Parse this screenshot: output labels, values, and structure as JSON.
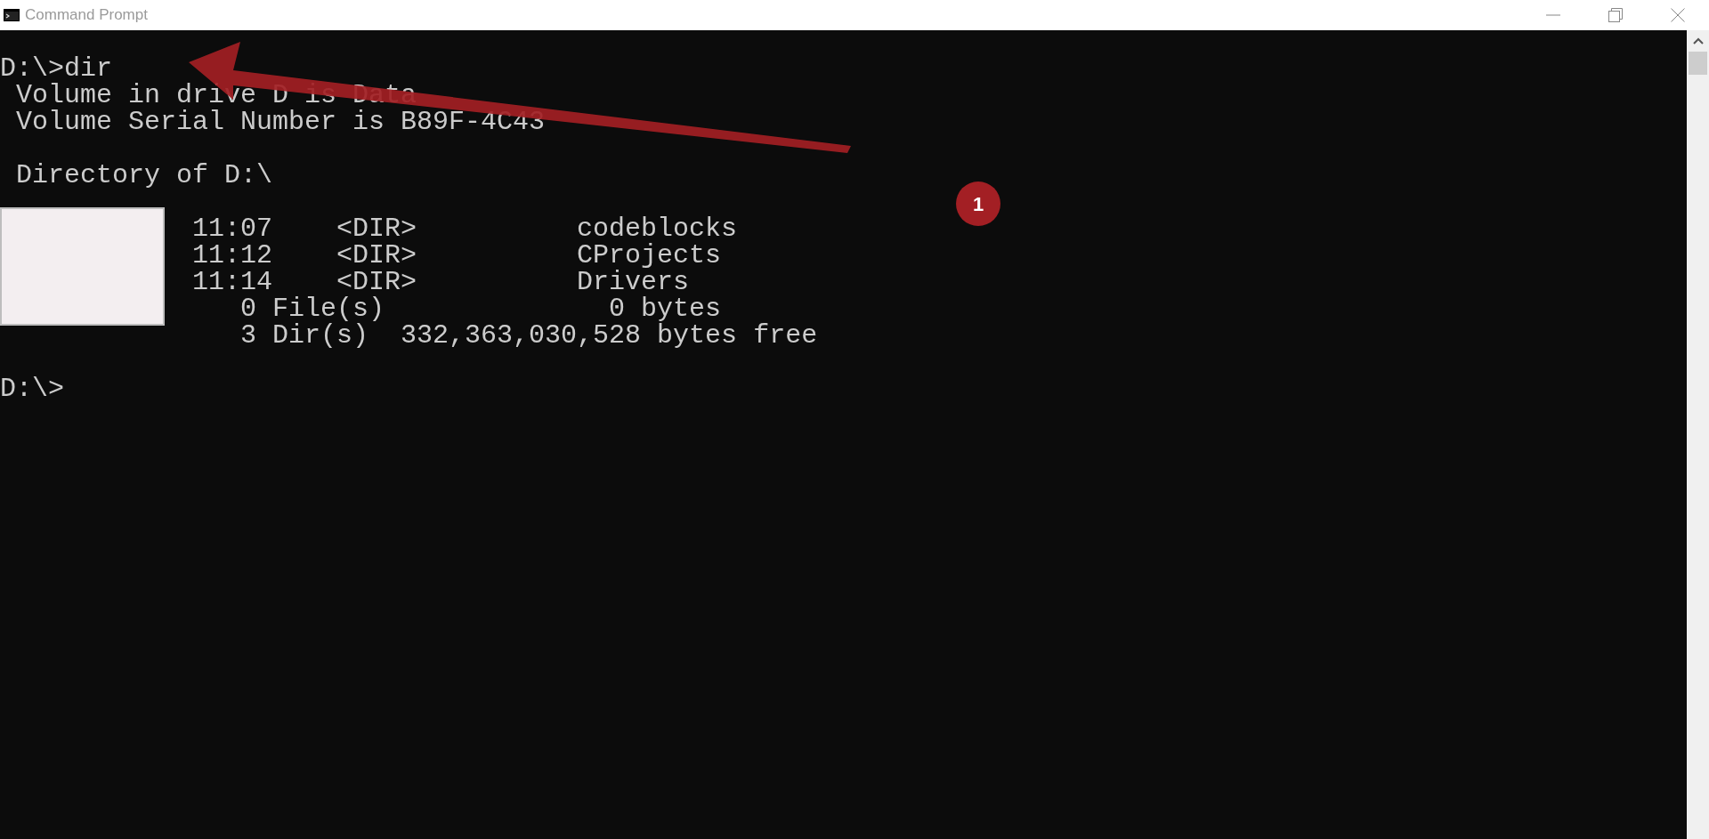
{
  "window": {
    "title": "Command Prompt"
  },
  "terminal": {
    "prompt": "D:\\>",
    "command": "dir",
    "volume_lines": [
      "Volume in drive D is Data",
      "Volume Serial Number is B89F-4C43"
    ],
    "directory_heading": "Directory of D:\\",
    "entries": [
      {
        "time": "11:07",
        "type": "<DIR>",
        "name": "codeblocks"
      },
      {
        "time": "11:12",
        "type": "<DIR>",
        "name": "CProjects"
      },
      {
        "time": "11:14",
        "type": "<DIR>",
        "name": "Drivers"
      }
    ],
    "summary": [
      "0 File(s)              0 bytes",
      "3 Dir(s)  332,363,030,528 bytes free"
    ],
    "final_prompt": "D:\\>"
  },
  "annotation": {
    "badge": "1"
  }
}
